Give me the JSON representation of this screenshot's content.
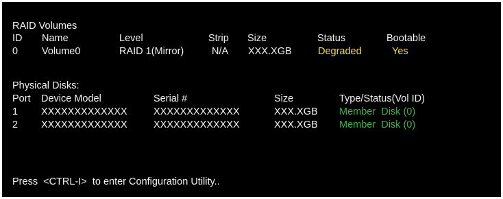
{
  "raid": {
    "title": "RAID Volumes",
    "headers": {
      "id": "ID",
      "name": "Name",
      "level": "Level",
      "strip": "Strip",
      "size": "Size",
      "status": "Status",
      "bootable": "Bootable"
    },
    "volumes": [
      {
        "id": "0",
        "name": "Volume0",
        "level": "RAID 1(Mirror)",
        "strip": "N/A",
        "size": "XXX.XGB",
        "status": "Degraded",
        "bootable": "Yes"
      }
    ]
  },
  "disks": {
    "title": "Physical Disks:",
    "headers": {
      "port": "Port",
      "model": "Device Model",
      "serial": "Serial #",
      "size": "Size",
      "type_status": "Type/Status(Vol ID)"
    },
    "rows": [
      {
        "port": "1",
        "model": "XXXXXXXXXXXXX",
        "serial": "XXXXXXXXXXXXX",
        "size": "XXX.XGB",
        "type_status": "Member  Disk (0)"
      },
      {
        "port": "2",
        "model": "XXXXXXXXXXXXX",
        "serial": "XXXXXXXXXXXXX",
        "size": "XXX.XGB",
        "type_status": "Member  Disk (0)"
      }
    ]
  },
  "footer": {
    "prompt": "Press  <CTRL-I>  to enter Configuration Utility.."
  },
  "colors": {
    "background": "#000000",
    "text": "#f2f2f2",
    "status_warning": "#f1e21c",
    "member_ok": "#3bb24a"
  }
}
